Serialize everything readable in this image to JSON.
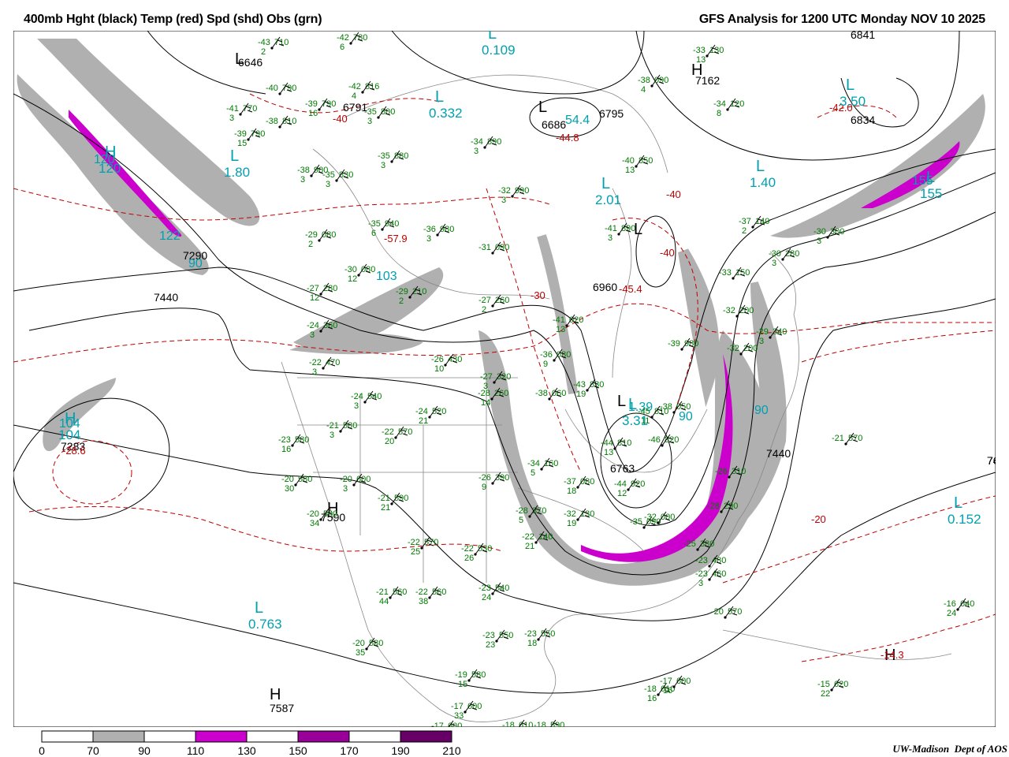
{
  "title": {
    "left": "400mb Hght (black) Temp (red) Spd (shd) Obs (grn)",
    "right": "GFS Analysis for 1200 UTC Monday  NOV 10 2025"
  },
  "credit": {
    "org": "UW-Madison",
    "dept": "Dept of AOS"
  },
  "colors": {
    "height_contour": "#000000",
    "temp_contour": "#c00000",
    "obs": "#007a00",
    "hl_marker": "#00a0b0",
    "map_lines": "#888888",
    "speed_70_90": "#b0b0b0",
    "speed_110_130": "#cc00cc",
    "speed_150_170": "#990099",
    "speed_190_210": "#660066"
  },
  "legend": {
    "ticks": [
      "0",
      "70",
      "90",
      "110",
      "130",
      "150",
      "170",
      "190",
      "210"
    ],
    "fills": [
      "#ffffff",
      "#b0b0b0",
      "#ffffff",
      "#cc00cc",
      "#ffffff",
      "#990099",
      "#ffffff",
      "#660066"
    ]
  },
  "height_labels": [
    "6841",
    "6834",
    "7162",
    "6686",
    "6791",
    "6646",
    "6795",
    "6960",
    "7290",
    "7440",
    "7440",
    "7440",
    "7283",
    "7590",
    "6763",
    "7587",
    "764"
  ],
  "temp_labels": [
    "-42.0",
    "-44.8",
    "-57.9",
    "-45.4",
    "-40",
    "-40",
    "-30",
    "-20",
    "-14.3",
    "-28.6",
    "-40"
  ],
  "speed_labels": [
    "120",
    "122",
    "90",
    "103",
    "155",
    "104",
    "90",
    "90",
    "1.39",
    "54.4"
  ],
  "hl_markers": [
    {
      "letter": "L",
      "value": "3.50"
    },
    {
      "letter": "L",
      "value": "1.40"
    },
    {
      "letter": "L",
      "value": "2.01"
    },
    {
      "letter": "L",
      "value": "0.332"
    },
    {
      "letter": "L",
      "value": "1.80"
    },
    {
      "letter": "L",
      "value": "0.152"
    },
    {
      "letter": "L",
      "value": "0.763"
    },
    {
      "letter": "H",
      "value": "120"
    },
    {
      "letter": "H",
      "value": "104"
    },
    {
      "letter": "L",
      "value": "3.31"
    },
    {
      "letter": "L",
      "value": "0.109"
    },
    {
      "letter": "L",
      "value": "155"
    }
  ],
  "obs": [
    {
      "t": "-43",
      "h": "710",
      "w": "2"
    },
    {
      "t": "-42",
      "h": "780",
      "w": "6"
    },
    {
      "t": "-40",
      "h": "790",
      "w": ""
    },
    {
      "t": "-41",
      "h": "770",
      "w": "3"
    },
    {
      "t": "-39",
      "h": "790",
      "w": "16"
    },
    {
      "t": "-38",
      "h": "810",
      "w": ""
    },
    {
      "t": "-39",
      "h": "790",
      "w": "15"
    },
    {
      "t": "-35",
      "h": "800",
      "w": "3"
    },
    {
      "t": "-42",
      "h": "816",
      "w": "4"
    },
    {
      "t": "-38",
      "h": "090",
      "w": "4"
    },
    {
      "t": "-33",
      "h": "130",
      "w": "13"
    },
    {
      "t": "-34",
      "h": "120",
      "w": "8"
    },
    {
      "t": "-34",
      "h": "890",
      "w": "3"
    },
    {
      "t": "-35",
      "h": "880",
      "w": "3"
    },
    {
      "t": "-38",
      "h": "900",
      "w": "3"
    },
    {
      "t": "-35",
      "h": "830",
      "w": "3"
    },
    {
      "t": "-40",
      "h": "850",
      "w": "13"
    },
    {
      "t": "-32",
      "h": "990",
      "w": "3"
    },
    {
      "t": "-41",
      "h": "890",
      "w": "3"
    },
    {
      "t": "-37",
      "h": "140",
      "w": "2"
    },
    {
      "t": "-30",
      "h": "300",
      "w": "3"
    },
    {
      "t": "-29",
      "h": "080",
      "w": "2"
    },
    {
      "t": "-35",
      "h": "940",
      "w": "6"
    },
    {
      "t": "-36",
      "h": "980",
      "w": "3"
    },
    {
      "t": "-31",
      "h": "090",
      "w": ""
    },
    {
      "t": "-30",
      "h": "280",
      "w": "3"
    },
    {
      "t": "-33",
      "h": "150",
      "w": ""
    },
    {
      "t": "-30",
      "h": "080",
      "w": "12"
    },
    {
      "t": "-29",
      "h": "210",
      "w": "2"
    },
    {
      "t": "-27",
      "h": "260",
      "w": "2"
    },
    {
      "t": "-32",
      "h": "200",
      "w": ""
    },
    {
      "t": "-27",
      "h": "280",
      "w": "12"
    },
    {
      "t": "-41",
      "h": "020",
      "w": "13"
    },
    {
      "t": "-29",
      "h": "340",
      "w": "3"
    },
    {
      "t": "-32",
      "h": "200",
      "w": ""
    },
    {
      "t": "-24",
      "h": "360",
      "w": "3"
    },
    {
      "t": "-39",
      "h": "980",
      "w": ""
    },
    {
      "t": "-36",
      "h": "080",
      "w": "9"
    },
    {
      "t": "-26",
      "h": "430",
      "w": "10"
    },
    {
      "t": "-22",
      "h": "470",
      "w": "3"
    },
    {
      "t": "-27",
      "h": "320",
      "w": "3"
    },
    {
      "t": "-28",
      "h": "260",
      "w": "14"
    },
    {
      "t": "-38",
      "h": "060",
      "w": ""
    },
    {
      "t": "-43",
      "h": "830",
      "w": "19"
    },
    {
      "t": "-45",
      "h": "810",
      "w": "11"
    },
    {
      "t": "-38",
      "h": "050",
      "w": ""
    },
    {
      "t": "-24",
      "h": "540",
      "w": "3"
    },
    {
      "t": "-24",
      "h": "520",
      "w": "21"
    },
    {
      "t": "-21",
      "h": "580",
      "w": "3"
    },
    {
      "t": "-22",
      "h": "570",
      "w": "20"
    },
    {
      "t": "-44",
      "h": "810",
      "w": "13"
    },
    {
      "t": "-46",
      "h": "820",
      "w": ""
    },
    {
      "t": "-21",
      "h": "570",
      "w": ""
    },
    {
      "t": "-23",
      "h": "580",
      "w": "16"
    },
    {
      "t": "-20",
      "h": "580",
      "w": "30"
    },
    {
      "t": "-20",
      "h": "600",
      "w": "3"
    },
    {
      "t": "-26",
      "h": "390",
      "w": "9"
    },
    {
      "t": "-34",
      "h": "160",
      "w": "5"
    },
    {
      "t": "-37",
      "h": "080",
      "w": "18"
    },
    {
      "t": "-44",
      "h": "920",
      "w": "12"
    },
    {
      "t": "-26",
      "h": "310",
      "w": ""
    },
    {
      "t": "-21",
      "h": "590",
      "w": "21"
    },
    {
      "t": "-20",
      "h": "590",
      "w": "34"
    },
    {
      "t": "-28",
      "h": "370",
      "w": "5"
    },
    {
      "t": "-32",
      "h": "130",
      "w": "19"
    },
    {
      "t": "-35",
      "h": "090",
      "w": ""
    },
    {
      "t": "-32",
      "h": "000",
      "w": ""
    },
    {
      "t": "-28",
      "h": "290",
      "w": ""
    },
    {
      "t": "-22",
      "h": "570",
      "w": "25"
    },
    {
      "t": "-22",
      "h": "530",
      "w": "26"
    },
    {
      "t": "-22",
      "h": "140",
      "w": "21"
    },
    {
      "t": "-25",
      "h": "380",
      "w": ""
    },
    {
      "t": "-23",
      "h": "480",
      "w": ""
    },
    {
      "t": "-21",
      "h": "560",
      "w": "44"
    },
    {
      "t": "-22",
      "h": "560",
      "w": "38"
    },
    {
      "t": "-23",
      "h": "540",
      "w": "24"
    },
    {
      "t": "-23",
      "h": "460",
      "w": "3"
    },
    {
      "t": "-20",
      "h": "570",
      "w": ""
    },
    {
      "t": "-16",
      "h": "640",
      "w": "24"
    },
    {
      "t": "-20",
      "h": "580",
      "w": "35"
    },
    {
      "t": "-23",
      "h": "550",
      "w": "23"
    },
    {
      "t": "-23",
      "h": "550",
      "w": "18"
    },
    {
      "t": "-19",
      "h": "580",
      "w": "15"
    },
    {
      "t": "-18",
      "h": "610",
      "w": "16"
    },
    {
      "t": "-17",
      "h": "600",
      "w": "16"
    },
    {
      "t": "-15",
      "h": "620",
      "w": "22"
    },
    {
      "t": "-17",
      "h": "600",
      "w": "33"
    },
    {
      "t": "-17",
      "h": "600",
      "w": ""
    },
    {
      "t": "-18",
      "h": "610",
      "w": ""
    },
    {
      "t": "-18",
      "h": "590",
      "w": ""
    }
  ]
}
